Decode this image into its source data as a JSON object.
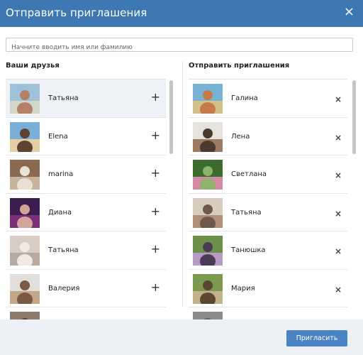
{
  "dialog": {
    "title": "Отправить приглашения",
    "close_icon": "×"
  },
  "search": {
    "placeholder": "Начните вводить имя или фамилию",
    "value": ""
  },
  "friends": {
    "title": "Ваши друзья",
    "items": [
      {
        "name": "Татьяна",
        "action": "+",
        "highlighted": true,
        "avatar_colors": [
          "#9ec0d8",
          "#d2d6c8",
          "#b67f67"
        ]
      },
      {
        "name": "Elena",
        "action": "+",
        "highlighted": false,
        "avatar_colors": [
          "#7aaed6",
          "#e3cfa5",
          "#5d4331"
        ]
      },
      {
        "name": "marina",
        "action": "+",
        "highlighted": false,
        "avatar_colors": [
          "#8a6a4f",
          "#c7b39b",
          "#e9e1d5"
        ]
      },
      {
        "name": "Диана",
        "action": "+",
        "highlighted": false,
        "avatar_colors": [
          "#3b1e4f",
          "#7c2f76",
          "#d3a49a"
        ]
      },
      {
        "name": "Татьяна",
        "action": "+",
        "highlighted": false,
        "avatar_colors": [
          "#d9ccc2",
          "#b9aaa1",
          "#f0e9e4"
        ]
      },
      {
        "name": "Валерия",
        "action": "+",
        "highlighted": false,
        "avatar_colors": [
          "#e2dedb",
          "#c3a789",
          "#7a5a44"
        ]
      },
      {
        "name": "",
        "action": "",
        "highlighted": false,
        "avatar_colors": [
          "#8c7a6b",
          "#b59b86",
          "#5b4a3d"
        ]
      }
    ]
  },
  "invites": {
    "title": "Отправить приглашения",
    "items": [
      {
        "name": "Галина",
        "action": "×",
        "avatar_colors": [
          "#78b3d4",
          "#d6c08a",
          "#c57c4a"
        ]
      },
      {
        "name": "Лена",
        "action": "×",
        "avatar_colors": [
          "#e6e2dc",
          "#9b7b61",
          "#4a3a30"
        ]
      },
      {
        "name": "Светлана",
        "action": "×",
        "avatar_colors": [
          "#3b6b2f",
          "#d48aa0",
          "#8fb26a"
        ]
      },
      {
        "name": "Татьяна",
        "action": "×",
        "avatar_colors": [
          "#d7cdbf",
          "#b48f77",
          "#6d5a4c"
        ]
      },
      {
        "name": "Танюшка",
        "action": "×",
        "avatar_colors": [
          "#6c8f4a",
          "#b79bc5",
          "#4d3a55"
        ]
      },
      {
        "name": "Мария",
        "action": "×",
        "avatar_colors": [
          "#7c9a4e",
          "#c2b28c",
          "#5a4633"
        ]
      },
      {
        "name": "",
        "action": "",
        "avatar_colors": [
          "#8c8c8c",
          "#b0b0b0",
          "#606060"
        ]
      }
    ]
  },
  "footer": {
    "invite_button": "Пригласить"
  },
  "colors": {
    "header": "#3d78b3",
    "button": "#4a84c5",
    "footer": "#edf1f5"
  }
}
